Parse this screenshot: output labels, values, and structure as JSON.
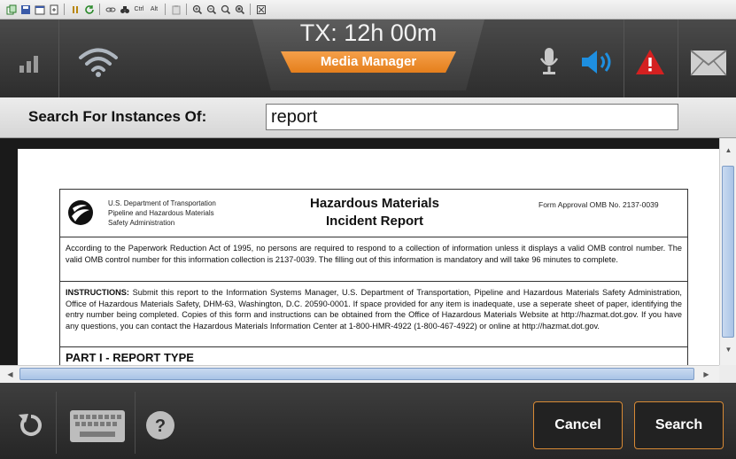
{
  "toolbar": {
    "icons": [
      "copy-icon",
      "save-icon",
      "properties-icon",
      "export-icon",
      "pause-icon",
      "refresh-icon",
      "link-icon",
      "binoculars-icon",
      "ctrl-key-icon",
      "alt-key-icon",
      "paste-icon",
      "zoom-in-icon",
      "zoom-out-icon",
      "zoom-reset-icon",
      "zoom-fit-icon",
      "fullscreen-icon"
    ],
    "ctrl_label": "Ctrl",
    "alt_label": "Alt"
  },
  "header": {
    "tx_time": "TX: 12h 00m",
    "tab_label": "Media Manager",
    "status_icons": [
      "signal-icon",
      "wifi-icon",
      "microphone-icon",
      "speaker-icon",
      "alert-icon",
      "mail-icon"
    ],
    "colors": {
      "accent": "#f0952f",
      "speaker": "#1e8fe0",
      "alert": "#d42020"
    }
  },
  "search": {
    "label": "Search For Instances Of:",
    "value": "report"
  },
  "document": {
    "dept_lines": [
      "U.S. Department of Transportation",
      "Pipeline and Hazardous Materials",
      "Safety Administration"
    ],
    "title_line1": "Hazardous Materials",
    "title_line2": "Incident Report",
    "omb": "Form Approval OMB No. 2137-0039",
    "paperwork": "According to the Paperwork Reduction Act of 1995, no persons are required to respond to a collection of information unless it displays a valid OMB control number. The valid OMB control number for this information collection is 2137-0039. The filling out of this information is mandatory and will take 96 minutes to complete.",
    "instructions_label": "INSTRUCTIONS:",
    "instructions": "Submit this report to the Information Systems Manager, U.S. Department of Transportation, Pipeline and Hazardous Materials Safety Administration, Office of Hazardous Materials Safety, DHM-63, Washington, D.C. 20590-0001. If space provided for any item is inadequate, use a seperate sheet of paper, identifying the entry number being completed. Copies of this form and instructions can be obtained from the Office of Hazardous Materials Website at http://hazmat.dot.gov. If you have any questions, you can contact the Hazardous Materials Information Center at 1-800-HMR-4922 (1-800-467-4922) or online at http://hazmat.dot.gov.",
    "part_heading": "PART I - REPORT TYPE"
  },
  "footer": {
    "cancel_label": "Cancel",
    "search_label": "Search",
    "help_glyph": "?"
  }
}
